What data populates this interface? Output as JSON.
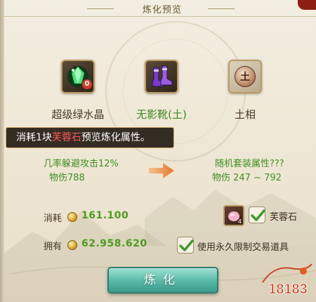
{
  "header": {
    "title": "炼化预览"
  },
  "items": [
    {
      "name": "超级绿水晶",
      "count": "0",
      "icon": "green-crystal-icon"
    },
    {
      "name": "无影靴(土)",
      "icon": "boots-icon"
    },
    {
      "name": "土相",
      "icon": "earth-element-icon",
      "glyph": "土"
    }
  ],
  "tooltip": {
    "prefix": "消耗1块",
    "highlight": "芙蓉石",
    "suffix": "预览炼化属性。"
  },
  "current_stats": [
    "几率躲避攻击12%",
    "物伤788"
  ],
  "preview_stats": [
    "随机套装属性???",
    "物伤 247 ~ 792"
  ],
  "cost": {
    "label": "消耗",
    "amount": "161.100"
  },
  "owned": {
    "label": "拥有",
    "amount": "62.958.620"
  },
  "material_option": {
    "label": "芙蓉石",
    "count": "4",
    "checked": true
  },
  "bound_option": {
    "label": "使用永久限制交易道具",
    "checked": true
  },
  "refine_button": {
    "label": "炼化"
  },
  "watermark": {
    "text": "18183"
  },
  "colors": {
    "green_text": "#3f8f24",
    "highlight": "#ff5757",
    "button": "#56b8a6"
  }
}
